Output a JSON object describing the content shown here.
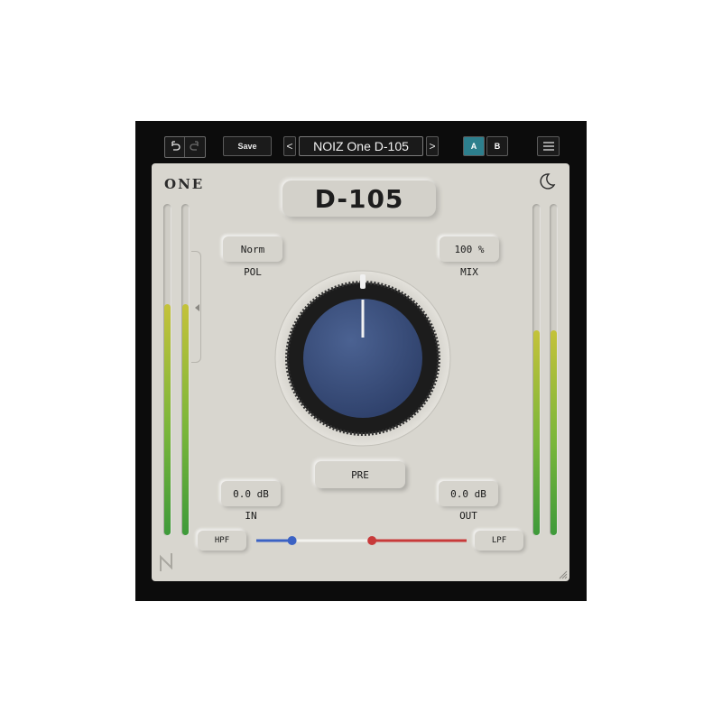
{
  "toolbar": {
    "save_label": "Save",
    "preset_name": "NOIZ One D-105",
    "prev_arrow": "<",
    "next_arrow": ">",
    "ab_a": "A",
    "ab_b": "B"
  },
  "panel": {
    "brand": "ONE",
    "title": "D-105",
    "pol": {
      "value": "Norm",
      "label": "POL"
    },
    "mix": {
      "value": "100 %",
      "label": "MIX"
    },
    "in": {
      "value": "0.0 dB",
      "label": "IN"
    },
    "out": {
      "value": "0.0 dB",
      "label": "OUT"
    },
    "pre_label": "PRE",
    "hpf_label": "HPF",
    "lpf_label": "LPF"
  },
  "meters": {
    "input_left_level": 0.7,
    "input_right_level": 0.7,
    "output_left_level": 0.62,
    "output_right_level": 0.62
  },
  "knob": {
    "position": 0.5
  },
  "filter": {
    "hpf_position": 0.17,
    "lpf_position": 0.55
  },
  "colors": {
    "accent_ab": "#2d7f8d",
    "knob_cap": "#3d5380",
    "hpf_color": "#3b62c4",
    "lpf_color": "#c83a3a",
    "panel_bg": "#d8d6cf"
  }
}
